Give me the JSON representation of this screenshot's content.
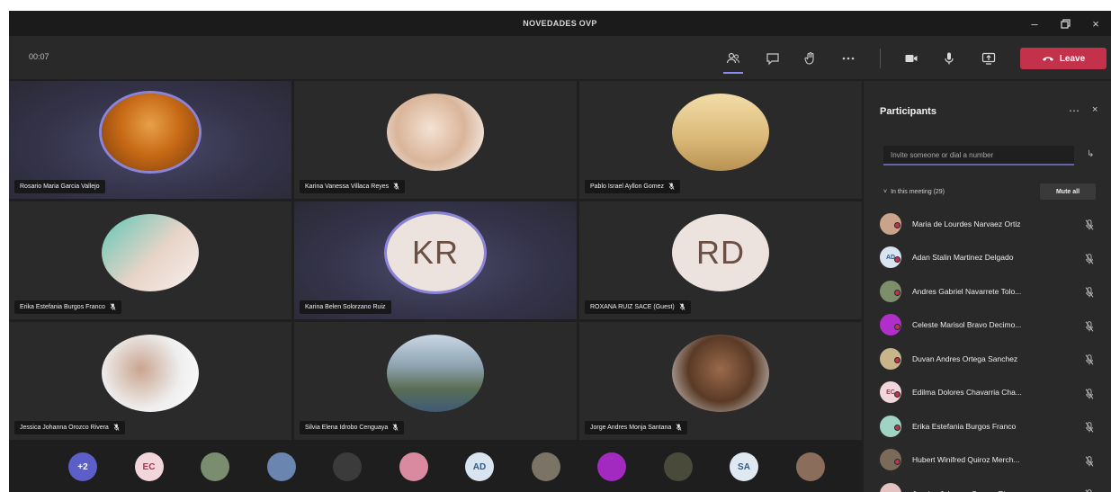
{
  "window": {
    "title": "NOVEDADES OVP"
  },
  "toolbar": {
    "timer": "00:07",
    "leave_label": "Leave"
  },
  "tiles": [
    {
      "name": "Rosario Maria Garcia Vallejo",
      "initials": "",
      "photo": "warm",
      "speaking": true,
      "ring": true,
      "mic": false
    },
    {
      "name": "Karina Vanessa Villaca Reyes",
      "initials": "",
      "photo": "light",
      "speaking": false,
      "ring": false,
      "mic": true
    },
    {
      "name": "Pablo Israel Ayllon Gomez",
      "initials": "",
      "photo": "frame",
      "speaking": false,
      "ring": false,
      "mic": true
    },
    {
      "name": "Erika Estefania Burgos Franco",
      "initials": "",
      "photo": "mint",
      "speaking": false,
      "ring": false,
      "mic": true
    },
    {
      "name": "Karina Belen Solorzano Ruiz",
      "initials": "KR",
      "photo": "",
      "speaking": true,
      "ring": true,
      "mic": false
    },
    {
      "name": "ROXANA RUIZ SACE (Guest)",
      "initials": "RD",
      "photo": "",
      "speaking": false,
      "ring": false,
      "mic": true
    },
    {
      "name": "Jessica Johanna Orozco Rivera",
      "initials": "",
      "photo": "white",
      "speaking": false,
      "ring": false,
      "mic": true
    },
    {
      "name": "Silvia Elena Idrobo Cenguaya",
      "initials": "",
      "photo": "landscape",
      "speaking": false,
      "ring": false,
      "mic": true
    },
    {
      "name": "Jorge Andres Monja Santana",
      "initials": "",
      "photo": "man",
      "speaking": false,
      "ring": false,
      "mic": true
    }
  ],
  "strip": [
    {
      "label": "+2",
      "bg": "#5b5fc7",
      "fg": "#ffffff"
    },
    {
      "label": "EC",
      "bg": "#f3d6dc",
      "fg": "#a4374f"
    },
    {
      "label": "",
      "bg": "#7a8d6e",
      "fg": "#ffffff"
    },
    {
      "label": "",
      "bg": "#6a86b0",
      "fg": "#ffffff"
    },
    {
      "label": "",
      "bg": "#3b3b3b",
      "fg": "#ffffff"
    },
    {
      "label": "",
      "bg": "#d98aa0",
      "fg": "#ffffff"
    },
    {
      "label": "AD",
      "bg": "#d8e4ef",
      "fg": "#2f5d8a"
    },
    {
      "label": "",
      "bg": "#7b7466",
      "fg": "#ffffff"
    },
    {
      "label": "",
      "bg": "#a22ac0",
      "fg": "#ffffff"
    },
    {
      "label": "",
      "bg": "#4a4a3a",
      "fg": "#ffffff"
    },
    {
      "label": "SA",
      "bg": "#dfe9f2",
      "fg": "#2f5d8a"
    },
    {
      "label": "",
      "bg": "#8a6d5a",
      "fg": "#ffffff"
    }
  ],
  "panel": {
    "title": "Participants",
    "invite_placeholder": "Invite someone or dial a number",
    "section_label": "In this meeting (29)",
    "mute_all_label": "Mute all",
    "participants": [
      {
        "name": "Maria de Lourdes Narvaez Ortiz",
        "initials": "",
        "bg": "#c9a38a"
      },
      {
        "name": "Adan Stalin Martinez Delgado",
        "initials": "AD",
        "bg": "#d8e4ef"
      },
      {
        "name": "Andres Gabriel Navarrete Tolo...",
        "initials": "",
        "bg": "#7c8e6a"
      },
      {
        "name": "Celeste Marisol Bravo Decimo...",
        "initials": "",
        "bg": "#b02ec9"
      },
      {
        "name": "Duvan Andres Ortega Sanchez",
        "initials": "",
        "bg": "#c9b58a"
      },
      {
        "name": "Edilma Dolores Chavarria Cha...",
        "initials": "EC",
        "bg": "#f3d6dc"
      },
      {
        "name": "Erika Estefania Burgos Franco",
        "initials": "",
        "bg": "#9fd4c4"
      },
      {
        "name": "Hubert Winifred Quiroz Merch...",
        "initials": "",
        "bg": "#7a6a5a"
      },
      {
        "name": "Jessica Johanna Orozco Rivera",
        "initials": "",
        "bg": "#e4c2c2"
      }
    ]
  },
  "colors": {
    "accent": "#6264a7",
    "leave": "#c4314b",
    "speaking_ring": "#8b84d7"
  }
}
